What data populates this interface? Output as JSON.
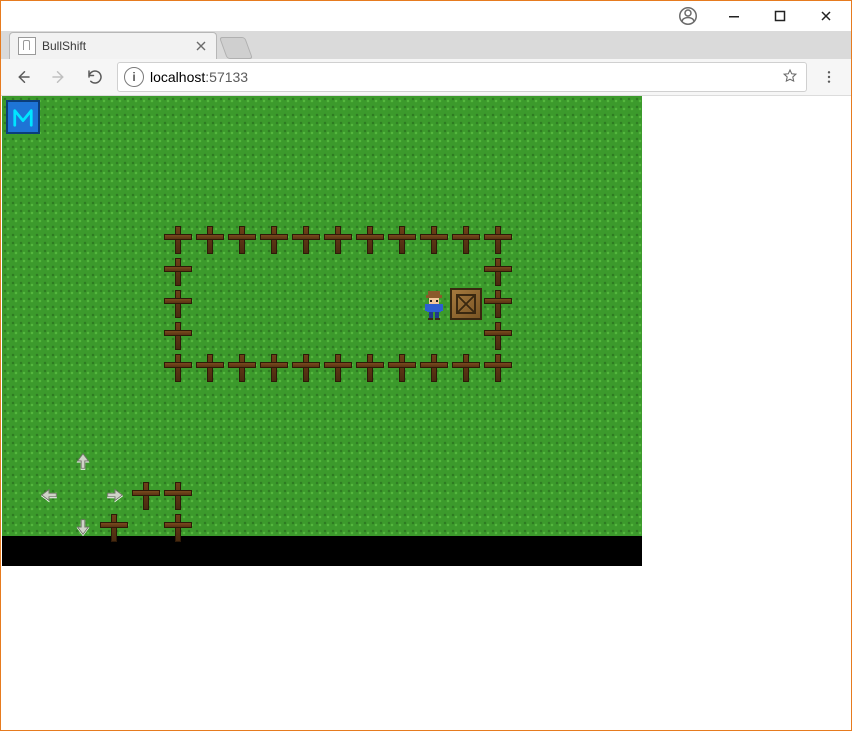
{
  "window": {
    "user_icon": "user-icon",
    "minimize_icon": "minimize-icon",
    "maximize_icon": "maximize-icon",
    "close_icon": "close-icon"
  },
  "tabs": [
    {
      "title": "BullShift",
      "favicon": "page-icon",
      "close_icon": "close-icon"
    }
  ],
  "new_tab_icon": "new-tab-icon",
  "nav": {
    "back_icon": "arrow-left-icon",
    "forward_icon": "arrow-right-icon",
    "reload_icon": "reload-icon"
  },
  "omnibox": {
    "info_icon": "info-icon",
    "info_label": "i",
    "url_host": "localhost",
    "url_port": ":57133",
    "star_icon": "star-icon"
  },
  "menu_icon": "menu-dots-icon",
  "game": {
    "badge_icon": "logo-M-icon",
    "tile_size_px": 32,
    "grid_cols": 20,
    "grid_rows_grass": 13.75,
    "fence_rect": {
      "left_col": 5,
      "top_row": 4,
      "right_col": 15,
      "bottom_row": 8
    },
    "fence_cells": [
      [
        5,
        4
      ],
      [
        6,
        4
      ],
      [
        7,
        4
      ],
      [
        8,
        4
      ],
      [
        9,
        4
      ],
      [
        10,
        4
      ],
      [
        11,
        4
      ],
      [
        12,
        4
      ],
      [
        13,
        4
      ],
      [
        14,
        4
      ],
      [
        15,
        4
      ],
      [
        5,
        5
      ],
      [
        15,
        5
      ],
      [
        5,
        6
      ],
      [
        15,
        6
      ],
      [
        5,
        7
      ],
      [
        15,
        7
      ],
      [
        5,
        8
      ],
      [
        6,
        8
      ],
      [
        7,
        8
      ],
      [
        8,
        8
      ],
      [
        9,
        8
      ],
      [
        10,
        8
      ],
      [
        11,
        8
      ],
      [
        12,
        8
      ],
      [
        13,
        8
      ],
      [
        14,
        8
      ],
      [
        15,
        8
      ]
    ],
    "player_cell": [
      13,
      6
    ],
    "crate_cell": [
      14,
      6
    ],
    "dpad": {
      "up_icon": "arrow-up-icon",
      "down_icon": "arrow-down-icon",
      "left_icon": "arrow-left-icon",
      "right_icon": "arrow-right-icon"
    },
    "toolbar_fences": [
      [
        4,
        12
      ],
      [
        5,
        12
      ],
      [
        3,
        13
      ],
      [
        5,
        13
      ]
    ]
  }
}
